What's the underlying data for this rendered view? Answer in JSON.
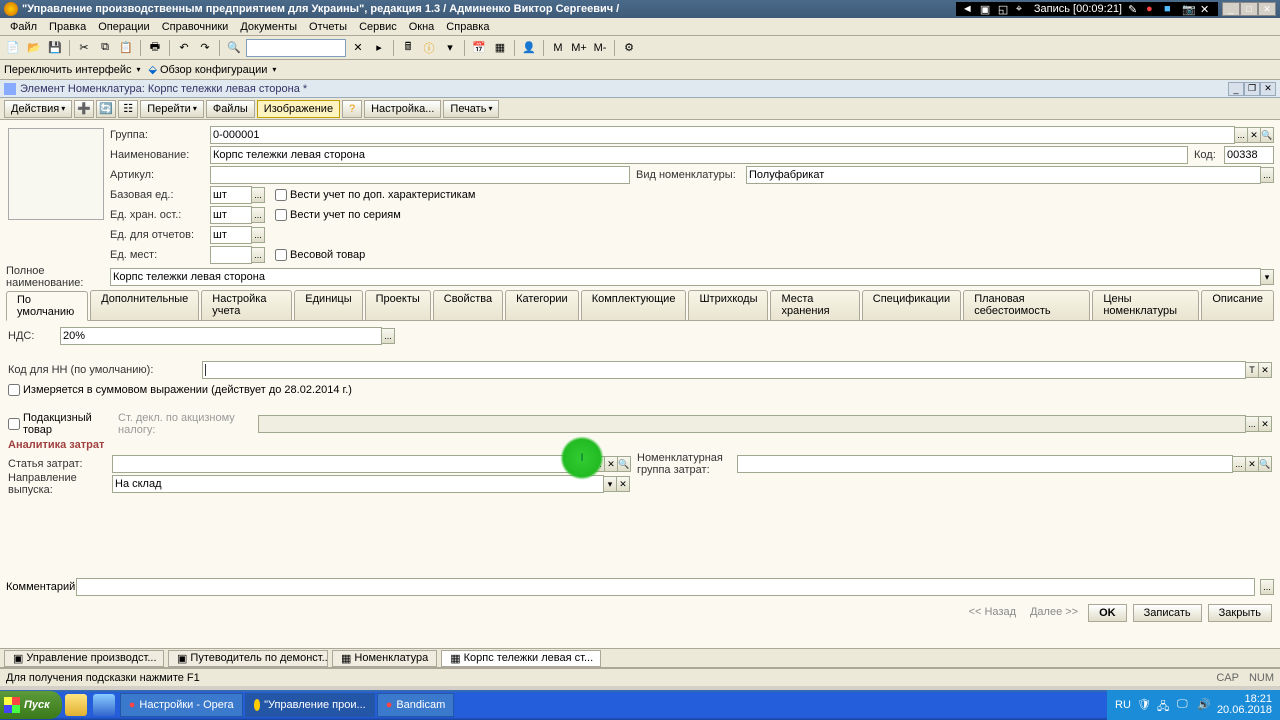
{
  "titlebar": "\"Управление производственным предприятием для Украины\", редакция 1.3 / Админенко Виктор Сергеевич /",
  "recording": "Запись  [00:09:21]",
  "menu": [
    "Файл",
    "Правка",
    "Операции",
    "Справочники",
    "Документы",
    "Отчеты",
    "Сервис",
    "Окна",
    "Справка"
  ],
  "tb2": {
    "switch": "Переключить интерфейс",
    "overview": "Обзор конфигурации"
  },
  "subtitle": "Элемент Номенклатура: Корпс тележки левая сторона *",
  "formtb": {
    "actions": "Действия",
    "goto": "Перейти",
    "files": "Файлы",
    "image": "Изображение",
    "setup": "Настройка...",
    "print": "Печать"
  },
  "labels": {
    "group": "Группа:",
    "name": "Наименование:",
    "code": "Код:",
    "article": "Артикул:",
    "nomtype": "Вид номенклатуры:",
    "baseunit": "Базовая ед.:",
    "storeunit": "Ед. хран. ост.:",
    "reportunit": "Ед. для отчетов:",
    "placeunit": "Ед. мест:",
    "fullname": "Полное наименование:",
    "vat": "НДС:",
    "nncode": "Код для НН (по умолчанию):",
    "measured": "Измеряется в суммовом выражении (действует до 28.02.2014 г.)",
    "excise": "Подакцизный товар",
    "excisedecl": "Ст. декл. по акцизному налогу:",
    "analytics": "Аналитика затрат",
    "costitem": "Статья затрат:",
    "nomgroup": "Номенклатурная группа затрат:",
    "outputdir": "Направление выпуска:",
    "comment": "Комментарий:",
    "chkchar": "Вести учет по доп. характеристикам",
    "chkseries": "Вести учет по сериям",
    "chkweight": "Весовой товар"
  },
  "values": {
    "group": "0-000001",
    "name": "Корпс тележки левая сторона",
    "code": "00338",
    "nomtype": "Полуфабрикат",
    "unit": "шт",
    "fullname": "Корпс тележки левая сторона",
    "vat": "20%",
    "outputdir": "На склад"
  },
  "tabs": [
    "По умолчанию",
    "Дополнительные",
    "Настройка учета",
    "Единицы",
    "Проекты",
    "Свойства",
    "Категории",
    "Комплектующие",
    "Штрихкоды",
    "Места хранения",
    "Спецификации",
    "Плановая себестоимость",
    "Цены номенклатуры",
    "Описание"
  ],
  "bottom": {
    "back": "<< Назад",
    "next": "Далее >>",
    "ok": "OK",
    "save": "Записать",
    "close": "Закрыть"
  },
  "wtabs": [
    "Управление производст...",
    "Путеводитель по демонст...",
    "Номенклатура",
    "Корпс тележки левая ст..."
  ],
  "status": {
    "help": "Для получения подсказки нажмите F1",
    "cap": "CAP",
    "num": "NUM"
  },
  "taskbar": {
    "start": "Пуск",
    "items": [
      "Настройки - Opera",
      "\"Управление прои...",
      "Bandicam"
    ],
    "lang": "RU",
    "time": "18:21",
    "date": "20.06.2018"
  }
}
